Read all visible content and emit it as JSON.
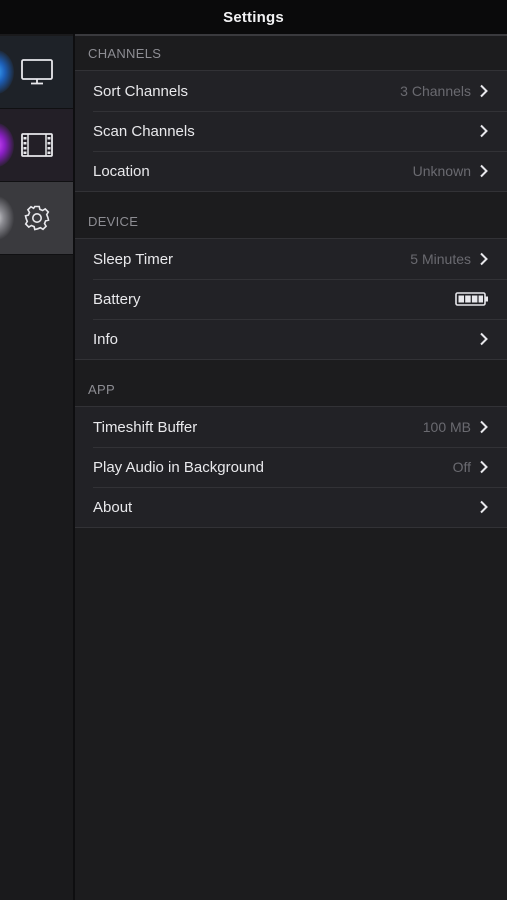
{
  "header": {
    "title": "Settings"
  },
  "sidebar": {
    "items": [
      {
        "icon": "tv-icon",
        "glow": "#3aa8ff"
      },
      {
        "icon": "film-icon",
        "glow": "#d24bff"
      },
      {
        "icon": "gear-icon",
        "selected": true
      }
    ]
  },
  "sections": {
    "channels": {
      "header": "CHANNELS",
      "rows": [
        {
          "label": "Sort Channels",
          "value": "3 Channels"
        },
        {
          "label": "Scan Channels",
          "value": ""
        },
        {
          "label": "Location",
          "value": "Unknown"
        }
      ]
    },
    "device": {
      "header": "DEVICE",
      "rows": [
        {
          "label": "Sleep Timer",
          "value": "5 Minutes"
        },
        {
          "label": "Battery",
          "value": "",
          "icon": "battery-icon",
          "level": 1.0
        },
        {
          "label": "Info",
          "value": ""
        }
      ]
    },
    "app": {
      "header": "APP",
      "rows": [
        {
          "label": "Timeshift Buffer",
          "value": "100 MB"
        },
        {
          "label": "Play Audio in Background",
          "value": "Off"
        },
        {
          "label": "About",
          "value": ""
        }
      ]
    }
  },
  "colors": {
    "background": "#1c1c1e",
    "row_background": "#222226",
    "section_header_text": "#8d8d93",
    "value_text": "#6a6a70"
  }
}
